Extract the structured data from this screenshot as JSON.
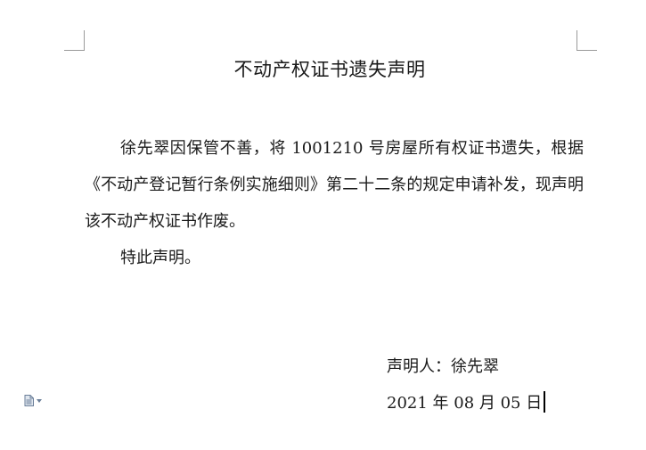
{
  "document": {
    "title": "不动产权证书遗失声明",
    "paragraph1": "徐先翠因保管不善，将 1001210 号房屋所有权证书遗失，根据《不动产登记暂行条例实施细则》第二十二条的规定申请补发，现声明该不动产权证书作废。",
    "paragraph2": "特此声明。",
    "signer": "声明人：徐先翠",
    "date": "2021 年 08 月 05 日"
  },
  "icons": {
    "doc_widget": "document-icon",
    "doc_widget_arrow": "chevron-down-icon"
  },
  "colors": {
    "text": "#1a1a1a",
    "margin_marks": "#9a9a9a",
    "widget_icon": "#6b7f99"
  }
}
